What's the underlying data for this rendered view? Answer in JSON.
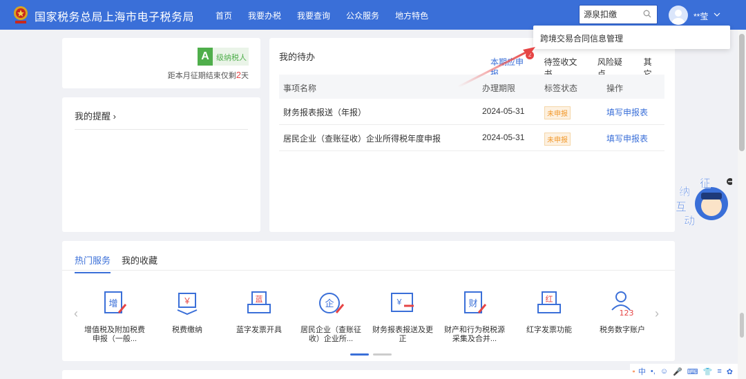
{
  "header": {
    "site_title": "国家税务总局上海市电子税务局",
    "nav": [
      "首页",
      "我要办税",
      "我要查询",
      "公众服务",
      "地方特色"
    ],
    "search_value": "源泉扣缴",
    "username": "**莹",
    "brand_color": "#3a6fd8"
  },
  "dropdown": {
    "suggestion": "跨境交易合同信息管理"
  },
  "credit_card": {
    "grade_letter": "A",
    "grade_text": "级纳税人",
    "deadline_prefix": "距本月征期结束仅剩",
    "deadline_days": "2",
    "deadline_suffix": "天"
  },
  "reminder": {
    "title": "我的提醒 ›"
  },
  "todo": {
    "title": "我的待办",
    "tabs": [
      "本期应申报",
      "待签收文书",
      "风险疑点",
      "其它"
    ],
    "tab_badge": "2",
    "columns": [
      "事项名称",
      "办理期限",
      "标签状态",
      "操作"
    ],
    "rows": [
      {
        "name": "财务报表报送（年报）",
        "deadline": "2024-05-31",
        "status": "未申报",
        "action": "填写申报表"
      },
      {
        "name": "居民企业（查账征收）企业所得税年度申报",
        "deadline": "2024-05-31",
        "status": "未申报",
        "action": "填写申报表"
      }
    ]
  },
  "services": {
    "tabs": [
      "热门服务",
      "我的收藏"
    ],
    "items": [
      {
        "label": "增值税及附加税费申报（一般...",
        "icon": "vat-form-icon",
        "glyph": "增"
      },
      {
        "label": "税费缴纳",
        "icon": "tax-payment-icon",
        "glyph": "￥"
      },
      {
        "label": "蓝字发票开具",
        "icon": "blue-invoice-icon",
        "glyph": "蓝"
      },
      {
        "label": "居民企业（查账征收）企业所...",
        "icon": "enterprise-tax-icon",
        "glyph": "企"
      },
      {
        "label": "财务报表报送及更正",
        "icon": "financial-report-icon",
        "glyph": "￥"
      },
      {
        "label": "财产和行为税税源采集及合并...",
        "icon": "property-tax-icon",
        "glyph": "财"
      },
      {
        "label": "红字发票功能",
        "icon": "red-invoice-icon",
        "glyph": "红"
      },
      {
        "label": "税务数字账户",
        "icon": "digital-account-icon",
        "glyph": "123"
      }
    ]
  },
  "widget": {
    "chars": [
      "征",
      "纳",
      "互",
      "动"
    ]
  },
  "ime": {
    "items": [
      "中",
      "•,",
      "☺",
      "🎤",
      "⌨",
      "👕",
      "≡",
      "✿"
    ]
  }
}
